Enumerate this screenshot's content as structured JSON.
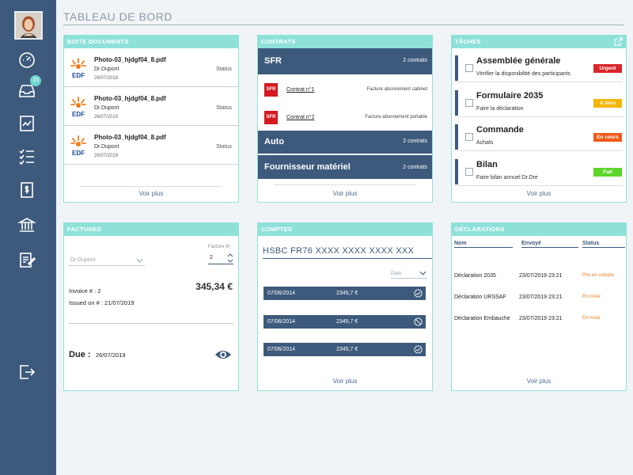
{
  "header": {
    "title": "TABLEAU DE BORD"
  },
  "sidebar": {
    "avatar_alt": "user-avatar",
    "inbox_badge": "15",
    "items": [
      "dashboard-icon",
      "inbox-icon",
      "report-icon",
      "checklist-icon",
      "invoice-icon",
      "bank-icon",
      "document-edit-icon",
      "logout-icon"
    ]
  },
  "documents": {
    "title": "BOITE DOCUMENTS",
    "logo_text": "EDF",
    "items": [
      {
        "name": "Photo-03_hjdgf04_8.pdf",
        "author": "Dr.Dupont",
        "date": "26/07/2019",
        "status": "Status"
      },
      {
        "name": "Photo-03_hjdgf04_8.pdf",
        "author": "Dr.Dupont",
        "date": "26/07/2019",
        "status": "Status"
      },
      {
        "name": "Photo-03_hjdgf04_8.pdf",
        "author": "Dr.Dupont",
        "date": "26/07/2019",
        "status": "Status"
      }
    ],
    "more": "Voir plus"
  },
  "contrats": {
    "title": "CONTRATS",
    "groups": [
      {
        "name": "SFR",
        "count": "2 contrats"
      },
      {
        "name": "Auto",
        "count": "2 contrats"
      },
      {
        "name": "Fournisseur matériel",
        "count": "2 contrats"
      }
    ],
    "sfr_logo": "SFR",
    "items": [
      {
        "label": "Contrat n°1",
        "desc": "Facture abonnement cabinet"
      },
      {
        "label": "Contrat n°2",
        "desc": "Facture abonnement portable"
      }
    ],
    "more": "Voir plus"
  },
  "taches": {
    "title": "TÂCHES",
    "items": [
      {
        "title": "Assemblée générale",
        "sub": "Vérifier la disponibilité des participants",
        "badge": "Urgent",
        "color": "#d9262b"
      },
      {
        "title": "Formulaire 2035",
        "sub": "Faire la déclaration",
        "badge": "A faire",
        "color": "#f2b705"
      },
      {
        "title": "Commande",
        "sub": "Achats",
        "badge": "En cours",
        "color": "#f05a1a"
      },
      {
        "title": "Bilan",
        "sub": "Faire bilan annuel Dr.Dre",
        "badge": "Fait",
        "color": "#5dd62c"
      }
    ],
    "more": "Voir plus"
  },
  "factures": {
    "title": "FACTURES",
    "client": "Dr.Dupont",
    "number_label": "Facture N°",
    "number": "2",
    "invoice": "Invoice # : 2",
    "issued": "Issued on  # : 21/07/2019",
    "amount": "345,34 €",
    "due_label": "Due :",
    "due_date": "26/07/2019"
  },
  "comptes": {
    "title": "COMPTES",
    "account": "HSBC FR76 XXXX XXXX XXXX XXX",
    "date_filter": "Date",
    "rows": [
      {
        "date": "07/06/2014",
        "amount": "2345,7 €",
        "icon": "check-circle-icon"
      },
      {
        "date": "07/06/2014",
        "amount": "2345,7 €",
        "icon": "blocked-circle-icon"
      },
      {
        "date": "07/06/2014",
        "amount": "2345,7 €",
        "icon": "check-circle-icon"
      }
    ],
    "more": "Voir plus"
  },
  "declarations": {
    "title": "DÉCLARATIONS",
    "cols": [
      "Nom",
      "Envoyé",
      "Status"
    ],
    "rows": [
      {
        "name": "Déclaration 2035",
        "date": "23/07/2019 23:21",
        "status": "Pris en compte"
      },
      {
        "name": "Déclaration URSSAF",
        "date": "23/07/2019 23:21",
        "status": "En route"
      },
      {
        "name": "Déclaration Embauche",
        "date": "23/07/2019 23:21",
        "status": "En route"
      }
    ],
    "more": "Voir plus"
  }
}
